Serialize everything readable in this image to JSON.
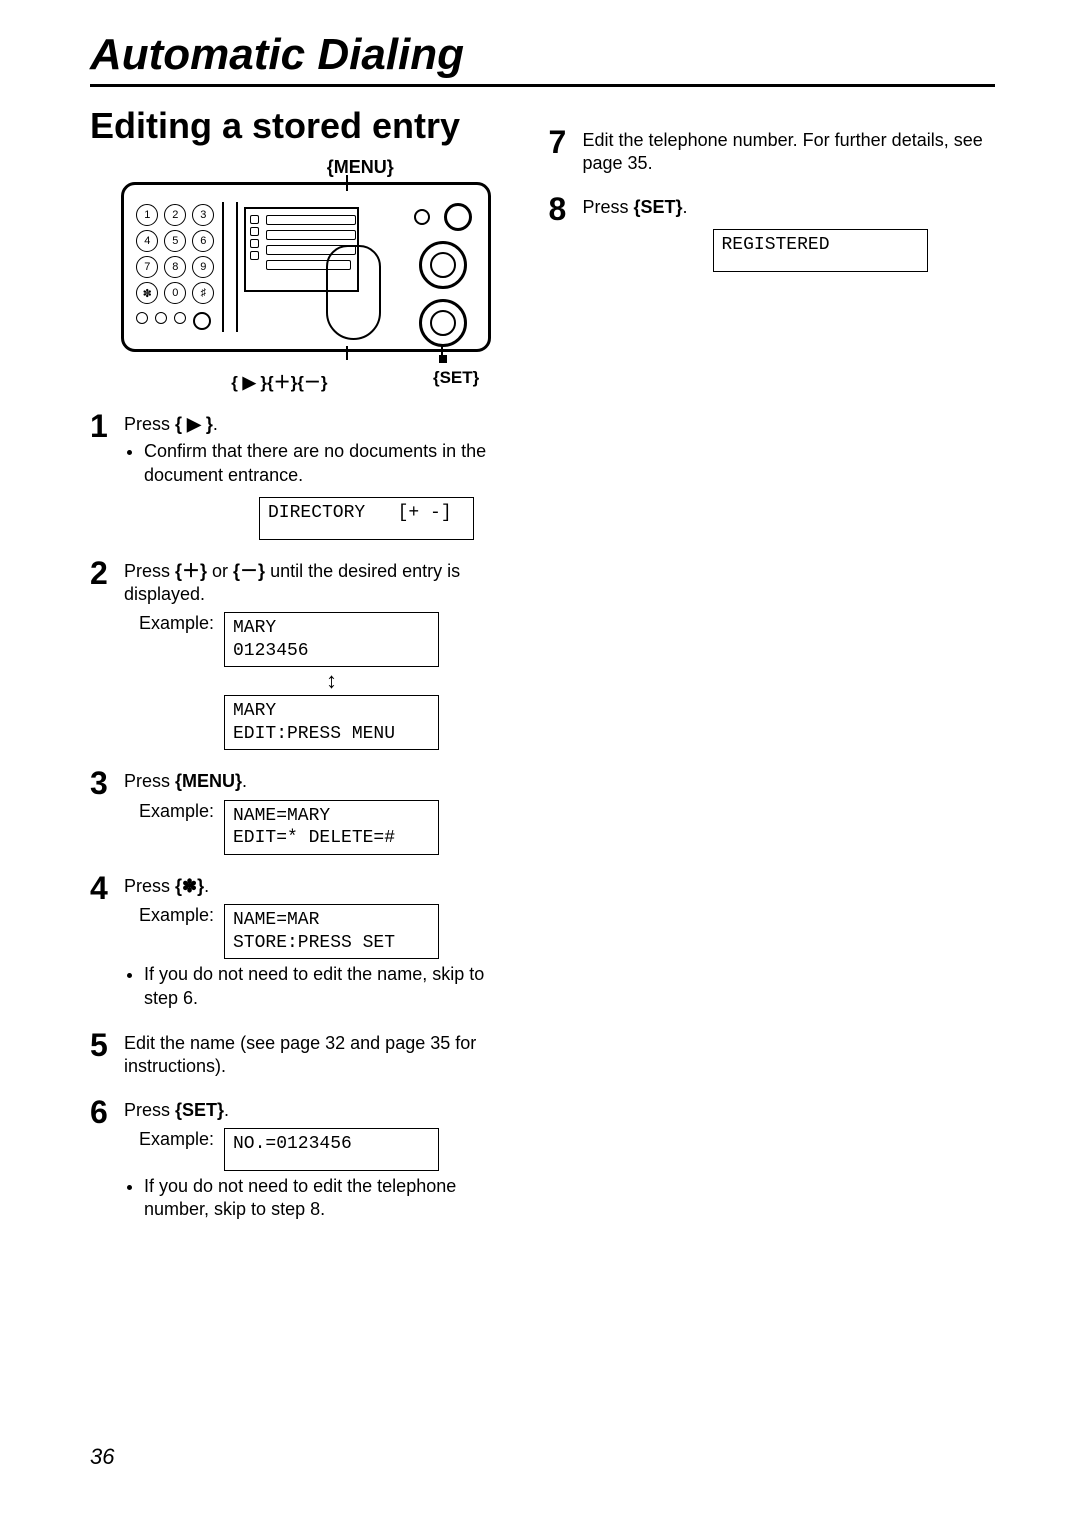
{
  "chapter_title": "Automatic Dialing",
  "section_heading": "Editing a stored entry",
  "panel": {
    "menu_label": "{MENU}",
    "nav_label": "{ ▶ }{＋}{－}",
    "set_label": "{SET}",
    "keys": [
      "1",
      "2",
      "3",
      "4",
      "5",
      "6",
      "7",
      "8",
      "9",
      "✽",
      "0",
      "♯"
    ]
  },
  "steps_left": {
    "s1": {
      "num": "1",
      "text_a": "Press ",
      "key": "{ ▶ }",
      "text_b": ".",
      "bullet": "Confirm that there are no documents in the document entrance.",
      "display": "DIRECTORY   [+ -]"
    },
    "s2": {
      "num": "2",
      "text_a": "Press ",
      "key1": "{＋}",
      "mid": " or ",
      "key2": "{－}",
      "text_b": " until the desired entry is displayed.",
      "example_label": "Example:",
      "display1": "MARY\n0123456",
      "between": "↕",
      "display2": "MARY\nEDIT:PRESS MENU"
    },
    "s3": {
      "num": "3",
      "text_a": "Press ",
      "key": "{MENU}",
      "text_b": ".",
      "example_label": "Example:",
      "display": "NAME=MARY\nEDIT=* DELETE=#"
    },
    "s4": {
      "num": "4",
      "text_a": "Press ",
      "key": "{✽}",
      "text_b": ".",
      "example_label": "Example:",
      "display": "NAME=MAR\nSTORE:PRESS SET",
      "bullet": "If you do not need to edit the name, skip to step 6."
    },
    "s5": {
      "num": "5",
      "text": "Edit the name (see page 32 and page 35 for instructions)."
    },
    "s6": {
      "num": "6",
      "text_a": "Press ",
      "key": "{SET}",
      "text_b": ".",
      "example_label": "Example:",
      "display": "NO.=0123456",
      "bullet": "If you do not need to edit the telephone number, skip to step 8."
    }
  },
  "steps_right": {
    "s7": {
      "num": "7",
      "text": "Edit the telephone number. For further details, see page 35."
    },
    "s8": {
      "num": "8",
      "text_a": "Press ",
      "key": "{SET}",
      "text_b": ".",
      "display": "REGISTERED"
    }
  },
  "page_number": "36"
}
